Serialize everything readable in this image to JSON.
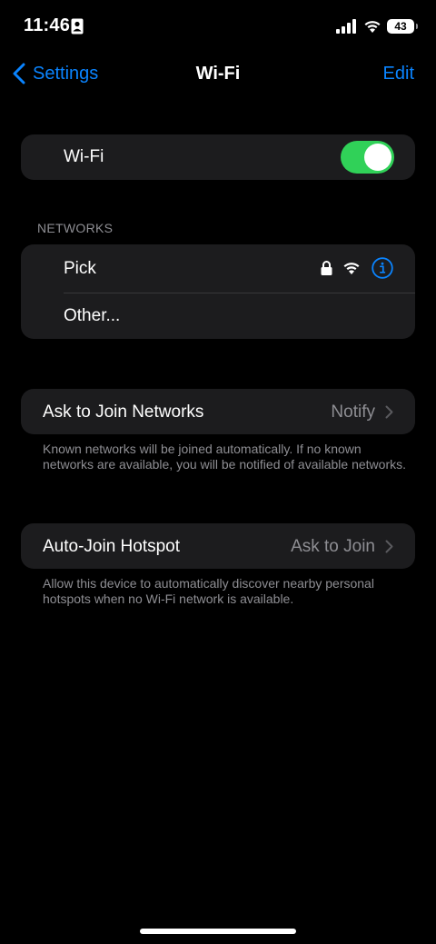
{
  "status_bar": {
    "time": "11:46",
    "battery": "43"
  },
  "nav": {
    "back_label": "Settings",
    "title": "Wi-Fi",
    "edit_label": "Edit"
  },
  "wifi": {
    "label": "Wi-Fi",
    "enabled": true
  },
  "networks": {
    "header": "NETWORKS",
    "items": [
      {
        "name": "Pick",
        "secured": true
      },
      {
        "name": "Other..."
      }
    ]
  },
  "ask_to_join": {
    "label": "Ask to Join Networks",
    "value": "Notify",
    "footnote": "Known networks will be joined automatically. If no known networks are available, you will be notified of available networks."
  },
  "auto_join_hotspot": {
    "label": "Auto-Join Hotspot",
    "value": "Ask to Join",
    "footnote": "Allow this device to automatically discover nearby personal hotspots when no Wi-Fi network is available."
  },
  "colors": {
    "accent": "#0a84ff",
    "toggle_on": "#30d158",
    "group_bg": "#1c1c1e",
    "secondary_text": "#8e8e93"
  }
}
